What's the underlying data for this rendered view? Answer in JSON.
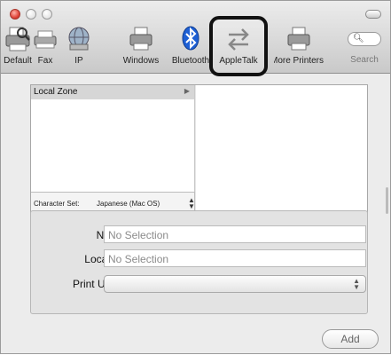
{
  "toolbar": {
    "items": [
      {
        "label": "Default",
        "icon": "default-printer-icon"
      },
      {
        "label": "Fax",
        "icon": "fax-icon"
      },
      {
        "label": "IP",
        "icon": "ip-globe-icon"
      },
      {
        "label": "Windows",
        "icon": "windows-printer-icon"
      },
      {
        "label": "Bluetooth",
        "icon": "bluetooth-icon"
      },
      {
        "label": "AppleTalk",
        "icon": "appletalk-arrows-icon"
      },
      {
        "label": "More Printers",
        "icon": "more-printers-icon"
      },
      {
        "label": "Search",
        "icon": "search-icon"
      }
    ],
    "selected": "AppleTalk"
  },
  "browser": {
    "left_column": [
      "Local Zone"
    ],
    "charset_label": "Character Set:",
    "charset_value": "Japanese (Mac OS)"
  },
  "form": {
    "name_label": "Name:",
    "name_value": "No Selection",
    "location_label": "Location:",
    "location_value": "No Selection",
    "print_using_label": "Print Using:",
    "print_using_value": ""
  },
  "actions": {
    "add_label": "Add"
  },
  "colors": {
    "window_bg": "#ececec",
    "highlight_border": "#111111",
    "bluetooth": "#1d5fd4"
  }
}
